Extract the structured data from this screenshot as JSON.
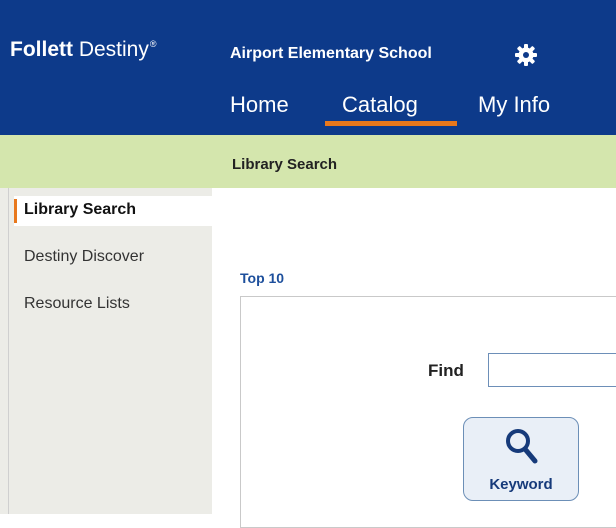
{
  "header": {
    "logo_bold": "Follett",
    "logo_rest": " Destiny",
    "logo_reg": "®",
    "school": "Airport Elementary School",
    "gear_icon": "gear-icon",
    "bg_color": "#0d3a8a"
  },
  "nav": {
    "items": [
      "Home",
      "Catalog",
      "My Info"
    ],
    "active": "Catalog",
    "active_color": "#e8781c"
  },
  "subnav": {
    "title": "Library Search"
  },
  "sidebar": {
    "items": [
      "Library Search",
      "Destiny Discover",
      "Resource Lists"
    ],
    "active": "Library Search"
  },
  "main": {
    "section_title": "Top 10",
    "find_label": "Find",
    "find_value": "",
    "keyword_button": "Keyword",
    "keyword_icon": "search-icon"
  }
}
